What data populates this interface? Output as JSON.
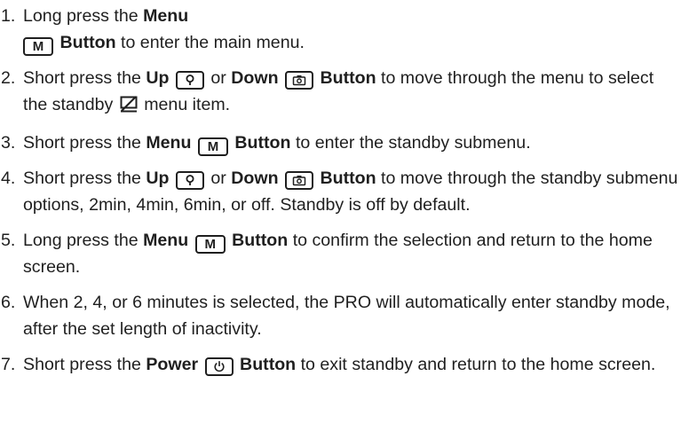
{
  "steps": [
    {
      "num": "1.",
      "t1": "Long press the ",
      "b1": "Menu",
      "key": "M",
      "b2": "Button",
      "t2": " to enter the main menu."
    },
    {
      "num": "2.",
      "t1": "Short press the ",
      "b1": "Up",
      "t2": " or ",
      "b2": "Down",
      "b3": "Button",
      "t3": " to move through the menu to select the standby ",
      "t4": " menu item."
    },
    {
      "num": "3.",
      "t1": "Short press the ",
      "b1": "Menu",
      "key": "M",
      "b2": "Button",
      "t2": " to enter the standby submenu."
    },
    {
      "num": "4.",
      "t1": "Short press the ",
      "b1": "Up",
      "t2": " or ",
      "b2": "Down",
      "b3": "Button",
      "t3": " to move through the standby submenu options, 2min, 4min, 6min, or off. Standby is off by default."
    },
    {
      "num": "5.",
      "t1": "Long press the ",
      "b1": "Menu",
      "key": "M",
      "b2": "Button",
      "t2": " to confirm the selection and return to the home screen."
    },
    {
      "num": "6.",
      "t1": "When 2, 4, or 6 minutes is selected, the PRO will automatically enter standby mode, after the set length of inactivity."
    },
    {
      "num": "7.",
      "t1": "Short press the ",
      "b1": "Power",
      "b2": "Button",
      "t2": " to exit standby and return to the home screen."
    }
  ],
  "icons": {
    "up_key": "magnifier-icon",
    "down_key": "camera-icon",
    "standby_item": "standby-icon",
    "power_key": "power-icon"
  }
}
